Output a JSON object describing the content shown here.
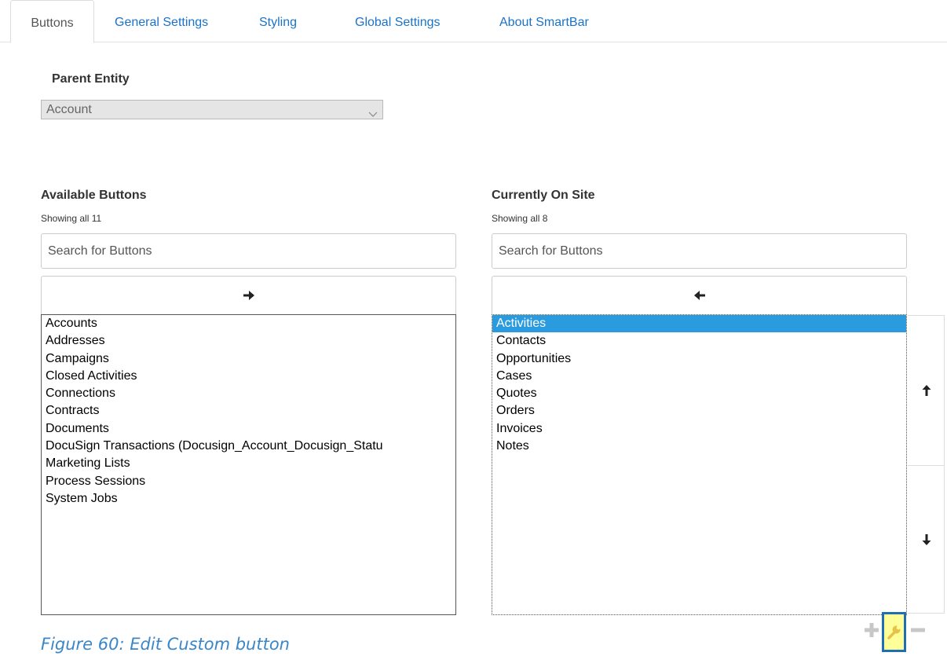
{
  "tabs": [
    {
      "label": "Buttons",
      "active": true
    },
    {
      "label": "General Settings",
      "active": false
    },
    {
      "label": "Styling",
      "active": false
    },
    {
      "label": "Global Settings",
      "active": false
    },
    {
      "label": "About SmartBar",
      "active": false
    }
  ],
  "parent_entity": {
    "label": "Parent Entity",
    "selected": "Account"
  },
  "available": {
    "title": "Available Buttons",
    "count_text": "Showing all 11",
    "search_placeholder": "Search for Buttons",
    "move_icon": "arrow-right-icon",
    "items": [
      "Accounts",
      "Addresses",
      "Campaigns",
      "Closed Activities",
      "Connections",
      "Contracts",
      "Documents",
      "DocuSign Transactions (Docusign_Account_Docusign_Statu",
      "Marketing Lists",
      "Process Sessions",
      "System Jobs"
    ]
  },
  "current": {
    "title": "Currently On Site",
    "count_text": "Showing all 8",
    "search_placeholder": "Search for Buttons",
    "move_icon": "arrow-left-icon",
    "selected_index": 0,
    "items": [
      "Activities",
      "Contacts",
      "Opportunities",
      "Cases",
      "Quotes",
      "Orders",
      "Invoices",
      "Notes"
    ]
  },
  "reorder": {
    "up_icon": "arrow-up-icon",
    "down_icon": "arrow-down-icon"
  },
  "actions": {
    "add_icon": "plus-icon",
    "edit_icon": "wrench-icon",
    "remove_icon": "minus-icon",
    "highlight_color": "#ffff99",
    "highlight_border": "#1f6fb5"
  },
  "caption": "Figure 60: Edit Custom button"
}
